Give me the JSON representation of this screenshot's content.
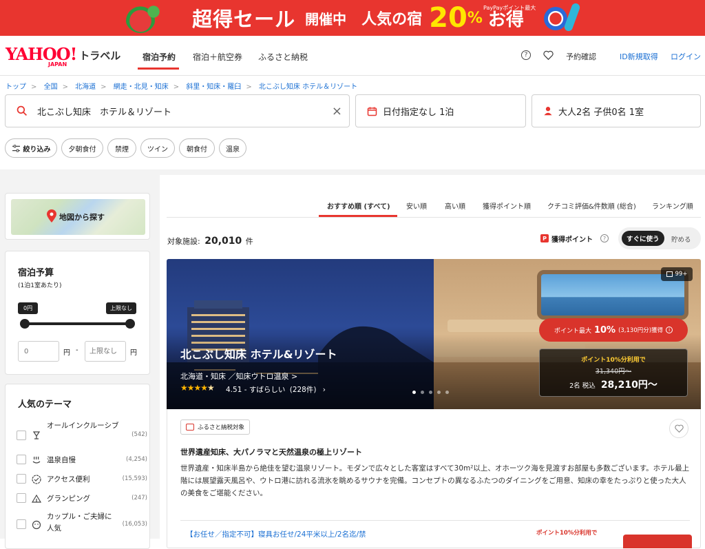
{
  "banner": {
    "sale": "超得セール",
    "status": "開催中",
    "popular": "人気の宿",
    "paypay_note": "PayPayポイント最大",
    "percent": "20",
    "percent_sign": "%",
    "deal": "お得"
  },
  "nav": {
    "logo_main": "YAHOO!",
    "logo_sub": "JAPAN",
    "logo_service": "トラベル",
    "tabs": [
      "宿泊予約",
      "宿泊＋航空券",
      "ふるさと納税"
    ],
    "help_icon": "question-icon",
    "favorite_icon": "heart-icon",
    "reservations": "予約確認",
    "register": "ID新規取得",
    "login": "ログイン"
  },
  "breadcrumbs": [
    "トップ",
    "全国",
    "北海道",
    "網走・北見・知床",
    "斜里・知床・羅臼",
    "北こぶし知床 ホテル＆リゾート"
  ],
  "search": {
    "keyword": "北こぶし知床　ホテル＆リゾート",
    "dates": "日付指定なし 1泊",
    "guests": "大人2名 子供0名 1室"
  },
  "filters": {
    "refine": "絞り込み",
    "chips": [
      "夕朝食付",
      "禁煙",
      "ツイン",
      "朝食付",
      "温泉"
    ]
  },
  "map": {
    "label": "地図から探す"
  },
  "budget": {
    "title": "宿泊予算",
    "subtitle": "(1泊1室あたり)",
    "min_label": "0円",
    "max_label": "上限なし",
    "min_placeholder": "0",
    "max_placeholder": "上限なし",
    "unit": "円",
    "dash": "-"
  },
  "themes": {
    "title": "人気のテーマ",
    "items": [
      {
        "label": "オールインクルーシブ",
        "count": "(542)",
        "icon": "glass-icon"
      },
      {
        "label": "温泉自慢",
        "count": "(4,254)",
        "icon": "hot-spring-icon"
      },
      {
        "label": "アクセス便利",
        "count": "(15,593)",
        "icon": "check-badge-icon"
      },
      {
        "label": "グランピング",
        "count": "(247)",
        "icon": "tent-icon"
      },
      {
        "label": "カップル・ご夫婦に人気",
        "count": "(16,053)",
        "icon": "couple-icon"
      }
    ]
  },
  "sort": {
    "tabs": [
      "おすすめ順 (すべて)",
      "安い順",
      "高い順",
      "獲得ポイント順",
      "クチコミ評価&件数順 (総合)",
      "ランキング順"
    ]
  },
  "results": {
    "label": "対象施設:",
    "count": "20,010",
    "unit": "件"
  },
  "points_toggle": {
    "label": "獲得ポイント",
    "use_now": "すぐに使う",
    "save": "貯める"
  },
  "hotel": {
    "name": "北こぶし知床 ホテル&リゾート",
    "area": "北海道・知床 ／知床ウトロ温泉 >",
    "rating": "4.51",
    "rating_text": "- すばらしい",
    "reviews": "(228件)",
    "stars": 4.5,
    "photo_count": "99+",
    "points_badge_prefix": "ポイント最大",
    "points_percent": "10%",
    "points_amount": "(3,130円分)獲得",
    "points_use": "ポイント10%分利用で",
    "price_old": "31,340円〜",
    "price_guests": "2名 税込",
    "price_new": "28,210円〜",
    "furusato_tag": "ふるさと納税対象",
    "catch": "世界遺産知床、大パノラマと天然温泉の極上リゾート",
    "description": "世界遺産・知床半島から絶佳を望む温泉リゾート。モダンで広々とした客室はすべて30m²以上、オホーツク海を見渡すお部屋も多数ございます。ホテル最上階には展望露天風呂や、ウトロ港に訪れる流氷を眺めるサウナを完備。コンセプトの異なるふたつのダイニングをご用意、知床の幸をたっぷりと使った大人の美食をご堪能ください。",
    "plan_title": "【お任せ／指定不可】寝具お任せ/24平米以上/2名迄/禁",
    "plan_points": "ポイント10%分利用で"
  }
}
